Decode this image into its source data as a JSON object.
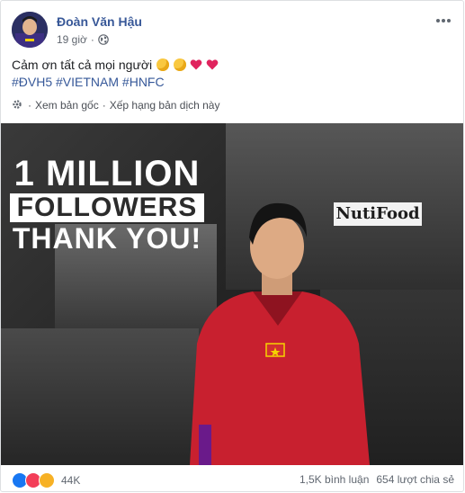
{
  "post": {
    "author": "Đoàn Văn Hậu",
    "time": "19 giờ",
    "privacy_icon": "globe-icon",
    "text_line": "Cảm ơn tất cả mọi người",
    "hashtags": "#ĐVH5 #VIETNAM #HNFC",
    "translate": {
      "see_original": "Xem bản gốc",
      "rate": "Xếp hạng bản dịch này"
    }
  },
  "photo": {
    "line1": "1 MILLION",
    "line2": "FOLLOWERS",
    "line3": "THANK YOU!",
    "sponsor": "NutiFood"
  },
  "footer": {
    "reaction_count": "44K",
    "comments": "1,5K bình luận",
    "shares": "654 lượt chia sẻ"
  },
  "colors": {
    "link": "#385898",
    "like": "#1877f2",
    "love": "#f33e58",
    "haha": "#f7b125",
    "jersey": "#c8202f"
  }
}
